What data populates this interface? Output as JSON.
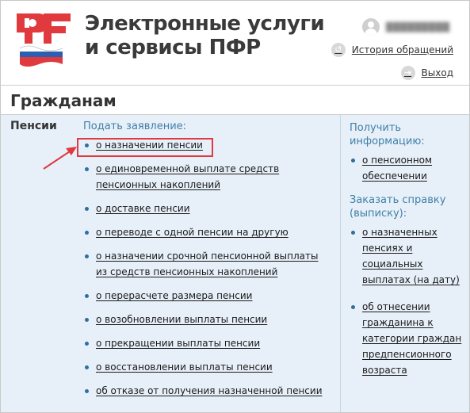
{
  "header": {
    "title_line1": "Электронные услуги",
    "title_line2": "и сервисы ПФР",
    "logo_icon": "pfr-logo-icon",
    "user": {
      "avatar_icon": "user-avatar-icon",
      "name": "█████████"
    },
    "history_label": "История обращений",
    "history_icon": "history-icon",
    "exit_label": "Выход",
    "exit_icon": "logout-icon"
  },
  "section": {
    "title": "Гражданам"
  },
  "category": "Пенсии",
  "apply": {
    "heading": "Подать заявление:",
    "items": [
      {
        "line1": "о назначении пенсии",
        "line2": ""
      },
      {
        "line1": "о единовременной выплате средств",
        "line2": "пенсионных накоплений"
      },
      {
        "line1": "о доставке пенсии",
        "line2": ""
      },
      {
        "line1": "о переводе с одной пенсии на другую",
        "line2": ""
      },
      {
        "line1": "о назначении срочной пенсионной выплаты",
        "line2": "из средств пенсионных накоплений"
      },
      {
        "line1": "о перерасчете размера пенсии",
        "line2": ""
      },
      {
        "line1": "о возобновлении выплаты пенсии",
        "line2": ""
      },
      {
        "line1": "о прекращении выплаты пенсии",
        "line2": ""
      },
      {
        "line1": "о восстановлении выплаты пенсии",
        "line2": ""
      },
      {
        "line1": "об отказе от получения назначенной пенсии",
        "line2": ""
      }
    ]
  },
  "info": {
    "heading_line1": "Получить",
    "heading_line2": "информацию:",
    "items": [
      {
        "line1": "о пенсионном",
        "line2": "обеспечении"
      }
    ]
  },
  "certificate": {
    "heading_line1": "Заказать справку",
    "heading_line2": "(выписку):",
    "items": [
      {
        "lines": [
          "о назначенных",
          "пенсиях и",
          "социальных",
          "выплатах (на дату)"
        ]
      },
      {
        "lines": [
          "об отнесении",
          "гражданина к",
          "категории граждан",
          "предпенсионного",
          "возраста"
        ]
      }
    ]
  },
  "colors": {
    "accent": "#3f7fa8",
    "highlight": "#e0393e",
    "panel_bg": "#e7f0f9"
  }
}
